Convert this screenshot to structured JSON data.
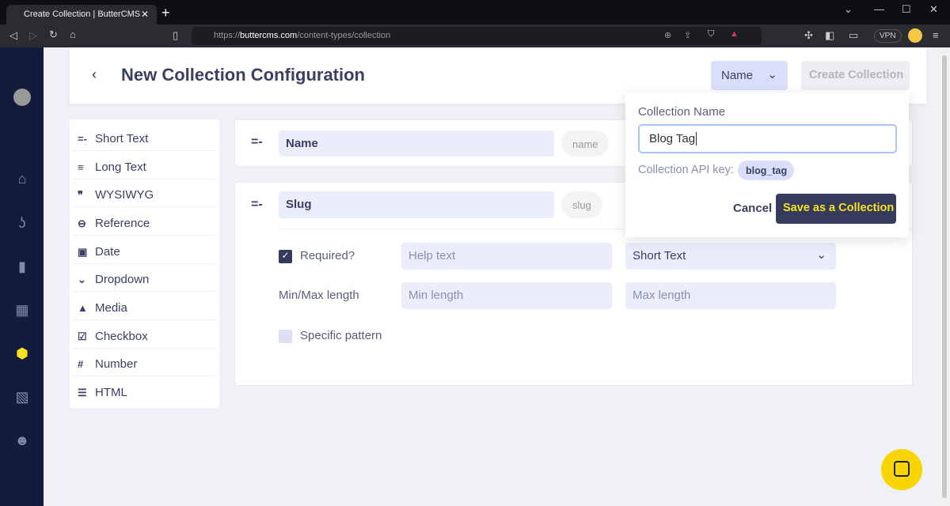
{
  "browser": {
    "tab_title": "Create Collection | ButterCMS",
    "url_prefix": "https://",
    "url_domain": "buttercms.com",
    "url_path": "/content-types/collection",
    "vpn": "VPN"
  },
  "header": {
    "title": "New Collection Configuration",
    "name_select": "Name",
    "create_button": "Create Collection"
  },
  "field_types": [
    {
      "icon": "=-",
      "label": "Short Text"
    },
    {
      "icon": "≡",
      "label": "Long Text"
    },
    {
      "icon": "❞",
      "label": "WYSIWYG"
    },
    {
      "icon": "⊖",
      "label": "Reference"
    },
    {
      "icon": "▣",
      "label": "Date"
    },
    {
      "icon": "⌄",
      "label": "Dropdown"
    },
    {
      "icon": "▲",
      "label": "Media"
    },
    {
      "icon": "☑",
      "label": "Checkbox"
    },
    {
      "icon": "#",
      "label": "Number"
    },
    {
      "icon": "☰",
      "label": "HTML"
    }
  ],
  "fields": [
    {
      "name": "Name",
      "key": "name"
    },
    {
      "name": "Slug",
      "key": "slug",
      "required_label": "Required?",
      "required": true,
      "help_placeholder": "Help text",
      "type_select": "Short Text",
      "minmax_label": "Min/Max length",
      "min_placeholder": "Min length",
      "max_placeholder": "Max length",
      "pattern_label": "Specific pattern",
      "pattern": false
    }
  ],
  "popover": {
    "label": "Collection Name",
    "value": "Blog Tag",
    "api_key_label": "Collection API key:",
    "api_key": "blog_tag",
    "cancel": "Cancel",
    "save": "Save as a Collection"
  },
  "colors": {
    "nav": "#141c3e",
    "accent": "#f8e21b",
    "button_dark": "#343b5c"
  }
}
